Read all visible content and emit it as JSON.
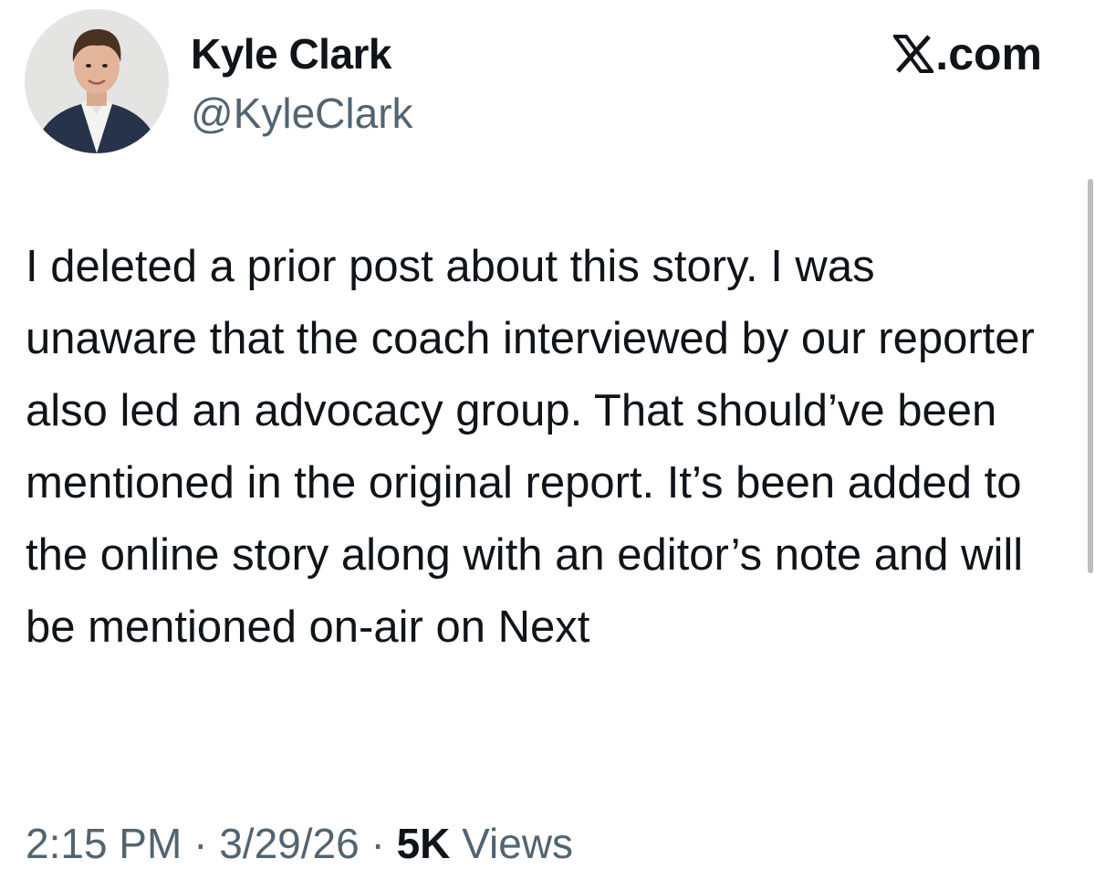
{
  "author": {
    "display_name": "Kyle Clark",
    "handle": "@KyleClark"
  },
  "brand": {
    "label": ".com",
    "icon": "x-logo-icon"
  },
  "tweet": {
    "text": "I deleted a prior post about this story. I was unaware that the coach interviewed by our reporter also led an advocacy group. That should’ve been mentioned in the original report. It’s been added to the online story along with an editor’s note and will be mentioned on-air on Next"
  },
  "meta": {
    "time": "2:15 PM",
    "separator": "·",
    "date": "3/29/26",
    "views_count": "5K",
    "views_label": "Views"
  },
  "colors": {
    "text_primary": "#0f1419",
    "text_secondary": "#536471",
    "background": "#ffffff",
    "scrollbar": "#bdbdbd"
  }
}
